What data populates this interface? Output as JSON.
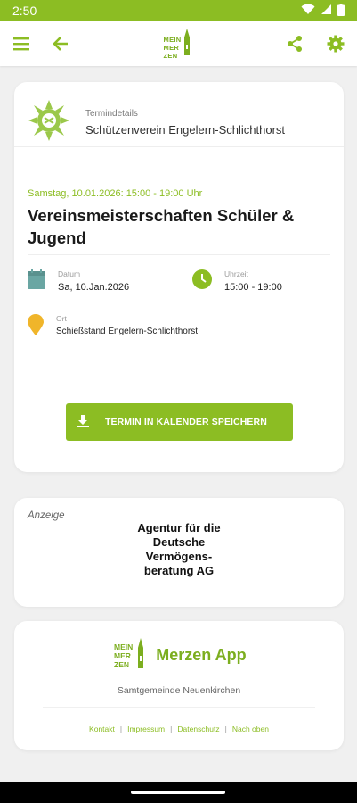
{
  "status": {
    "time": "2:50"
  },
  "header": {
    "logo": {
      "line1": "MEIN",
      "line2": "MER",
      "line3": "ZEN"
    },
    "icons": [
      "menu-icon",
      "back-arrow-icon",
      "share-icon",
      "gear-icon"
    ]
  },
  "event": {
    "section_label": "Termindetails",
    "organizer": "Schützenverein Engelern-Schlichthorst",
    "date_line": "Samstag, 10.01.2026: 15:00 - 19:00 Uhr",
    "title": "Vereinsmeisterschaften Schüler & Jugend",
    "date_label": "Datum",
    "date_value": "Sa, 10.Jan.2026",
    "time_label": "Uhrzeit",
    "time_value": "15:00 - 19:00",
    "place_label": "Ort",
    "place_value": "Schießstand Engelern-Schlichthorst",
    "save_button": "TERMIN IN KALENDER SPEICHERN"
  },
  "ad": {
    "label": "Anzeige",
    "line1": "Agentur für die",
    "line2": "Deutsche",
    "line3": "Vermögens-",
    "line4": "beratung AG"
  },
  "footer": {
    "logo": {
      "line1": "MEIN",
      "line2": "MER",
      "line3": "ZEN"
    },
    "app_name": "Merzen App",
    "subtitle": "Samtgemeinde Neuenkirchen",
    "links": [
      "Kontakt",
      "Impressum",
      "Datenschutz",
      "Nach oben"
    ]
  },
  "colors": {
    "accent": "#8cbd23",
    "date_icon": "#6aa6a3",
    "place_icon": "#f0b52a"
  }
}
